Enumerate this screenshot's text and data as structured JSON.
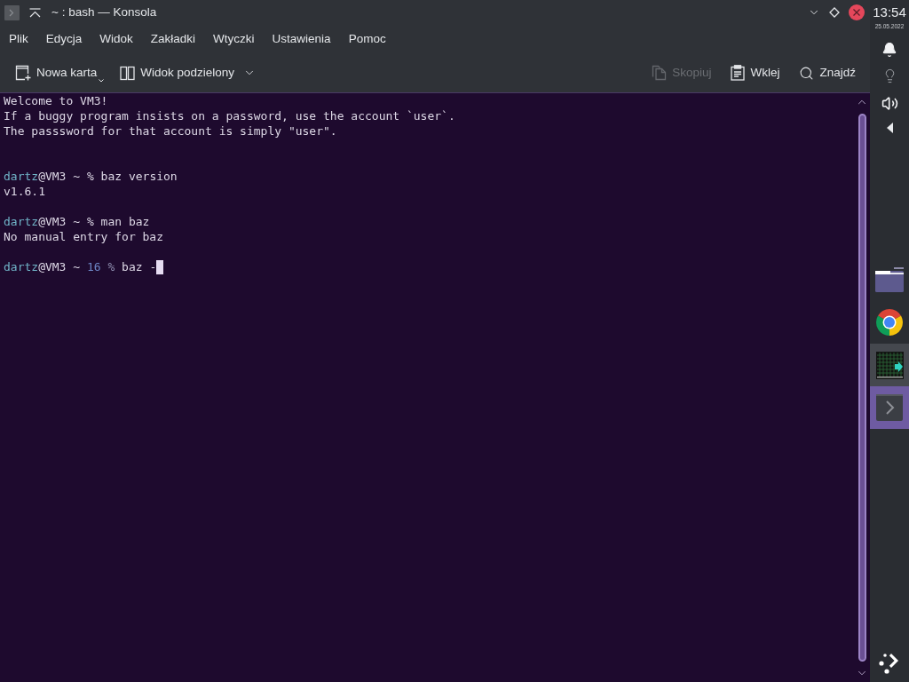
{
  "window": {
    "title": "~ : bash — Konsola"
  },
  "menu": [
    "Plik",
    "Edycja",
    "Widok",
    "Zakładki",
    "Wtyczki",
    "Ustawienia",
    "Pomoc"
  ],
  "toolbar": {
    "left": [
      {
        "kind": "new-tab",
        "label": "Nowa karta",
        "disabled": false,
        "menu_indicator": true,
        "dropdown": false
      },
      {
        "kind": "split",
        "label": "Widok podzielony",
        "disabled": false,
        "menu_indicator": false,
        "dropdown": true
      }
    ],
    "right": [
      {
        "kind": "copy",
        "label": "Skopiuj",
        "disabled": true,
        "menu_indicator": false,
        "dropdown": false
      },
      {
        "kind": "paste",
        "label": "Wklej",
        "disabled": false,
        "menu_indicator": false,
        "dropdown": false
      },
      {
        "kind": "find",
        "label": "Znajdź",
        "disabled": false,
        "menu_indicator": false,
        "dropdown": false
      }
    ]
  },
  "terminal": {
    "lines": [
      {
        "kind": "output",
        "text": "Welcome to VM3!"
      },
      {
        "kind": "output",
        "text": "If a buggy program insists on a password, use the account `user`."
      },
      {
        "kind": "output",
        "text": "The passsword for that account is simply \"user\"."
      },
      {
        "kind": "blank"
      },
      {
        "kind": "blank"
      },
      {
        "kind": "prompt",
        "user": "dartz",
        "host": "@VM3",
        "path": "~",
        "symbol": "%",
        "command": "baz version",
        "cursor": false
      },
      {
        "kind": "output",
        "text": "v1.6.1"
      },
      {
        "kind": "blank"
      },
      {
        "kind": "prompt",
        "user": "dartz",
        "host": "@VM3",
        "path": "~",
        "symbol": "%",
        "command": "man baz",
        "cursor": false
      },
      {
        "kind": "output",
        "text": "No manual entry for baz"
      },
      {
        "kind": "blank"
      },
      {
        "kind": "prompt",
        "user": "dartz",
        "host": "@VM3",
        "path": "~",
        "status": "16",
        "symbol": "%",
        "command": "baz -",
        "cursor": true
      }
    ]
  },
  "panel": {
    "clock": {
      "time": "13:54",
      "date": "25.05.2022"
    },
    "tasks": [
      {
        "kind": "folder",
        "running": false,
        "selected": false
      },
      {
        "kind": "browser",
        "running": false,
        "selected": false
      },
      {
        "kind": "monitor",
        "running": true,
        "selected": false
      },
      {
        "kind": "terminal",
        "running": true,
        "selected": true
      }
    ]
  }
}
